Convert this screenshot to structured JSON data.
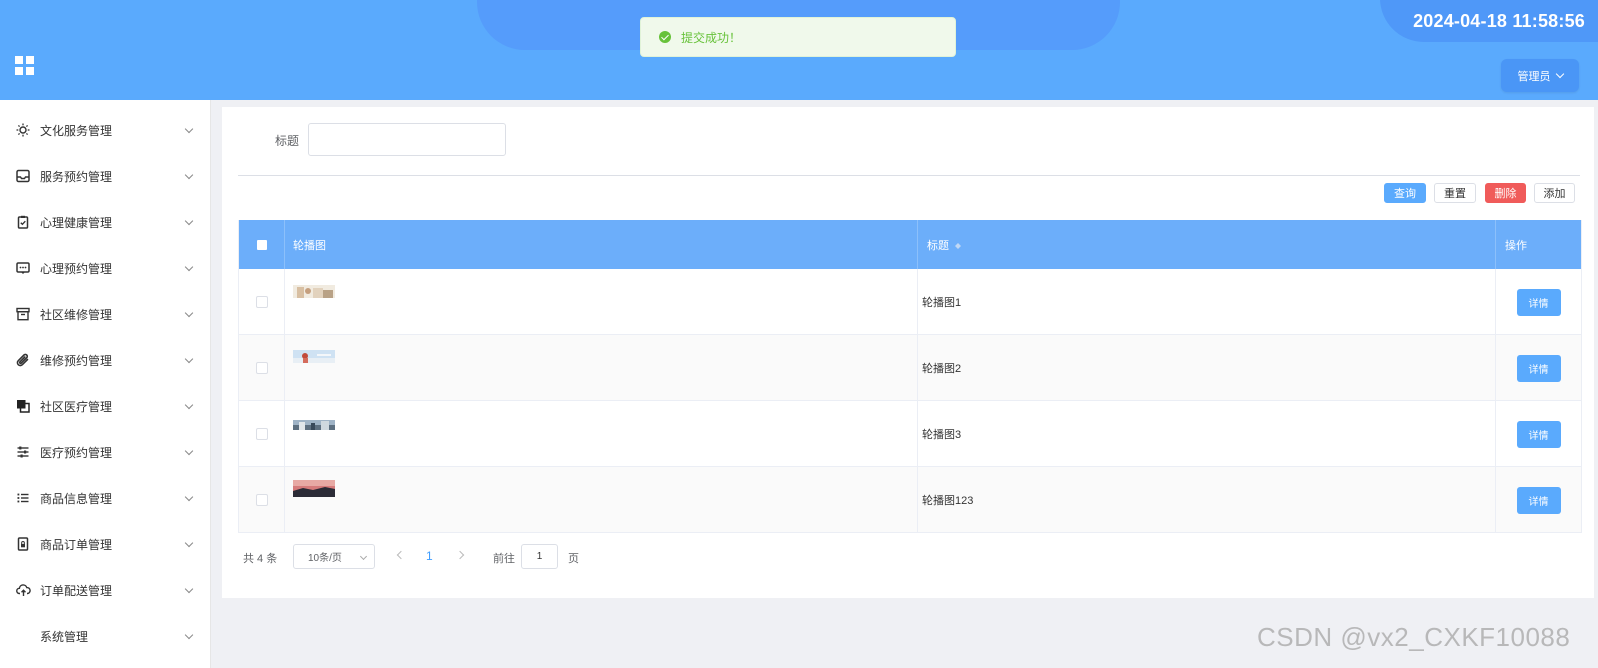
{
  "header": {
    "datetime": "2024-04-18 11:58:56",
    "admin_label": "管理员"
  },
  "toast": {
    "message": "提交成功！"
  },
  "sidebar": {
    "items": [
      {
        "label": "文化服务管理",
        "icon": "sun-icon"
      },
      {
        "label": "服务预约管理",
        "icon": "inbox-icon"
      },
      {
        "label": "心理健康管理",
        "icon": "clipboard-check-icon"
      },
      {
        "label": "心理预约管理",
        "icon": "message-box-icon"
      },
      {
        "label": "社区维修管理",
        "icon": "archive-box-icon"
      },
      {
        "label": "维修预约管理",
        "icon": "paperclip-icon"
      },
      {
        "label": "社区医疗管理",
        "icon": "copy-squares-icon"
      },
      {
        "label": "医疗预约管理",
        "icon": "sliders-icon"
      },
      {
        "label": "商品信息管理",
        "icon": "list-icon"
      },
      {
        "label": "商品订单管理",
        "icon": "lock-doc-icon"
      },
      {
        "label": "订单配送管理",
        "icon": "cloud-upload-icon"
      },
      {
        "label": "系统管理",
        "icon": ""
      }
    ]
  },
  "search": {
    "title_label": "标题",
    "title_value": ""
  },
  "toolbar": {
    "query": "查询",
    "reset": "重置",
    "delete": "删除",
    "add": "添加"
  },
  "table": {
    "columns": {
      "image": "轮播图",
      "title": "标题",
      "operation": "操作"
    },
    "rows": [
      {
        "title": "轮播图1",
        "action": "详情",
        "thumb_colors": [
          "#e8d7c3",
          "#c9b49a",
          "#f4ede2"
        ]
      },
      {
        "title": "轮播图2",
        "action": "详情",
        "thumb_colors": [
          "#b9d6ef",
          "#e9f1f8",
          "#c34a3a"
        ]
      },
      {
        "title": "轮播图3",
        "action": "详情",
        "thumb_colors": [
          "#6e8aa5",
          "#d3dce4",
          "#3b4b5a"
        ]
      },
      {
        "title": "轮播图123",
        "action": "详情",
        "thumb_colors": [
          "#c86b6b",
          "#e6a0a0",
          "#2a2a35"
        ]
      }
    ]
  },
  "pagination": {
    "total": "共 4 条",
    "page_size": "10条/页",
    "current_page": "1",
    "goto_prefix": "前往",
    "goto_value": "1",
    "goto_suffix": "页"
  },
  "watermark": "CSDN @vx2_CXKF10088",
  "colors": {
    "header_bg": "#5aaafd",
    "table_header_bg": "#6caefa",
    "primary": "#5aaafd",
    "danger": "#f05b5a",
    "success": "#67c23a"
  }
}
